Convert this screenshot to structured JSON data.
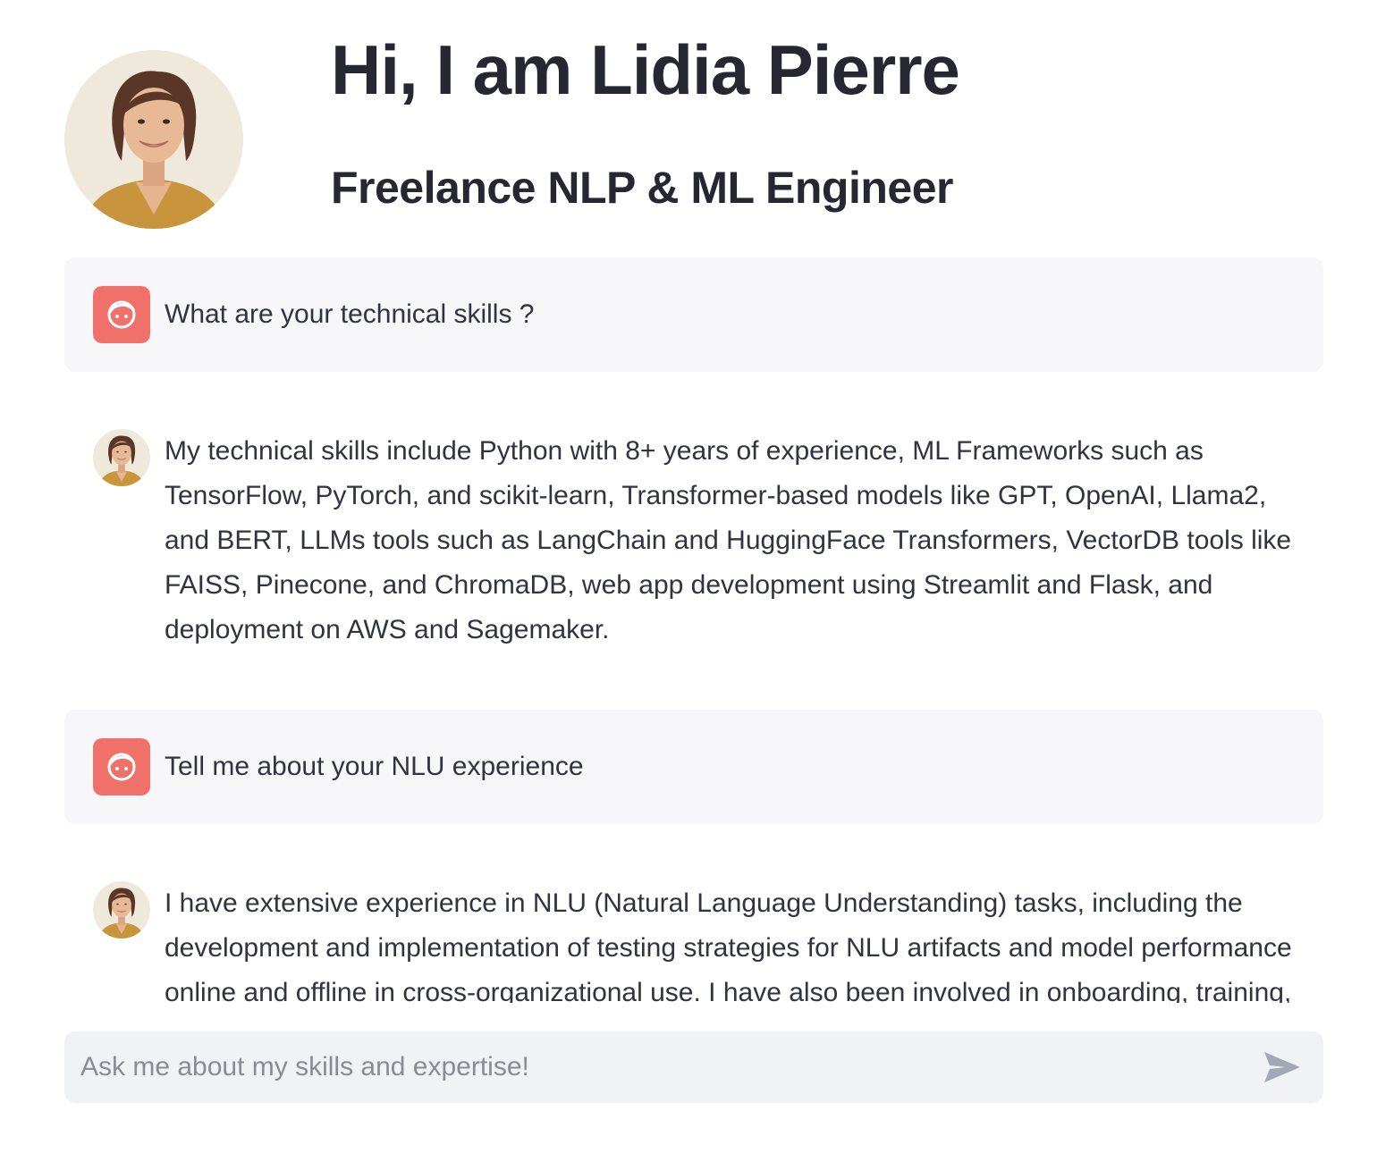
{
  "header": {
    "title": "Hi, I am Lidia Pierre",
    "subtitle": "Freelance NLP & ML Engineer"
  },
  "chat": {
    "messages": [
      {
        "role": "user",
        "text": "What are your technical skills ?"
      },
      {
        "role": "assistant",
        "text": "My technical skills include Python with 8+ years of experience, ML Frameworks such as TensorFlow, PyTorch, and scikit-learn, Transformer-based models like GPT, OpenAI, Llama2, and BERT, LLMs tools such as LangChain and HuggingFace Transformers, VectorDB tools like FAISS, Pinecone, and ChromaDB, web app development using Streamlit and Flask, and deployment on AWS and Sagemaker."
      },
      {
        "role": "user",
        "text": "Tell me about your NLU experience"
      },
      {
        "role": "assistant",
        "text": "I have extensive experience in NLU (Natural Language Understanding) tasks, including the development and implementation of testing strategies for NLU artifacts and model performance online and offline in cross-organizational use. I have also been involved in onboarding, training,"
      }
    ]
  },
  "input": {
    "placeholder": "Ask me about my skills and expertise!",
    "value": ""
  },
  "icons": {
    "user_avatar": "face-icon",
    "send": "send-icon"
  },
  "colors": {
    "user_avatar_bg": "#f0706a",
    "user_message_bg": "#f7f7f9",
    "input_bg": "#f0f2f6",
    "text": "#31333f",
    "heading": "#262730"
  }
}
